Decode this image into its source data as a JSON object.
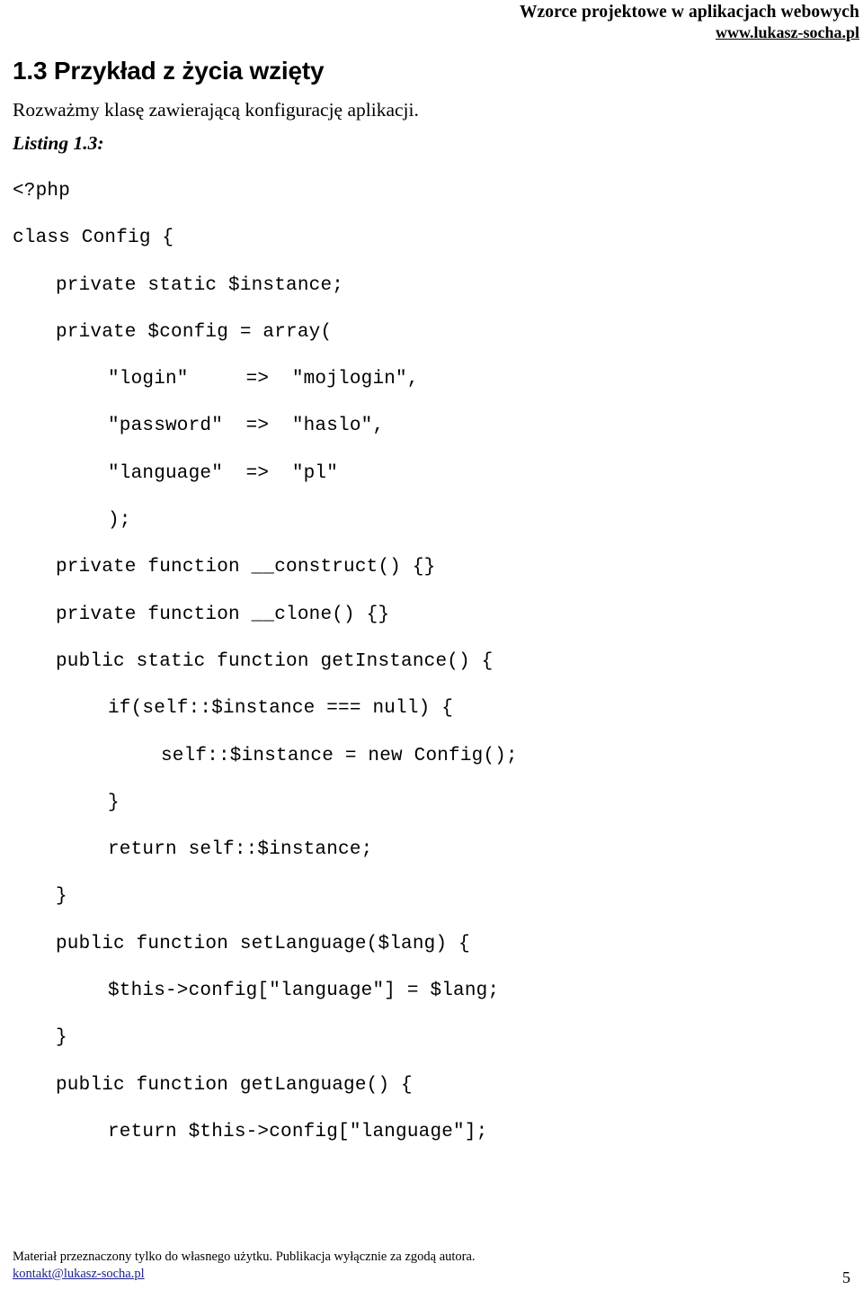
{
  "header": {
    "title": "Wzorce projektowe w aplikacjach webowych",
    "url": "www.lukasz-socha.pl"
  },
  "section": {
    "heading": "1.3 Przykład z życia wzięty",
    "intro": "Rozważmy klasę zawierającą konfigurację aplikacji.",
    "listing_label": "Listing 1.3:"
  },
  "code": {
    "language": "php",
    "lines": [
      {
        "indent": 0,
        "text": "<?php"
      },
      {
        "indent": 0,
        "text": "class Config {"
      },
      {
        "indent": 1,
        "text": "private static $instance;"
      },
      {
        "indent": 1,
        "text": "private $config = array("
      },
      {
        "indent": 2,
        "text": "\"login\"     =>  \"mojlogin\","
      },
      {
        "indent": 2,
        "text": "\"password\"  =>  \"haslo\","
      },
      {
        "indent": 2,
        "text": "\"language\"  =>  \"pl\""
      },
      {
        "indent": 2,
        "text": ");"
      },
      {
        "indent": 1,
        "text": "private function __construct() {}"
      },
      {
        "indent": 1,
        "text": "private function __clone() {}"
      },
      {
        "indent": 1,
        "text": "public static function getInstance() {"
      },
      {
        "indent": 2,
        "text": "if(self::$instance === null) {"
      },
      {
        "indent": 3,
        "text": "self::$instance = new Config();"
      },
      {
        "indent": 2,
        "text": "}"
      },
      {
        "indent": 2,
        "text": "return self::$instance;"
      },
      {
        "indent": 1,
        "text": "}"
      },
      {
        "indent": 1,
        "text": "public function setLanguage($lang) {"
      },
      {
        "indent": 2,
        "text": "$this->config[\"language\"] = $lang;"
      },
      {
        "indent": 1,
        "text": "}"
      },
      {
        "indent": 1,
        "text": "public function getLanguage() {"
      },
      {
        "indent": 2,
        "text": "return $this->config[\"language\"];"
      }
    ]
  },
  "footer": {
    "note": "Materiał przeznaczony tylko do własnego użytku. Publikacja wyłącznie za zgodą autora.",
    "email": "kontakt@lukasz-socha.pl",
    "page_number": "5",
    "link_color": "#1d1d8c"
  }
}
